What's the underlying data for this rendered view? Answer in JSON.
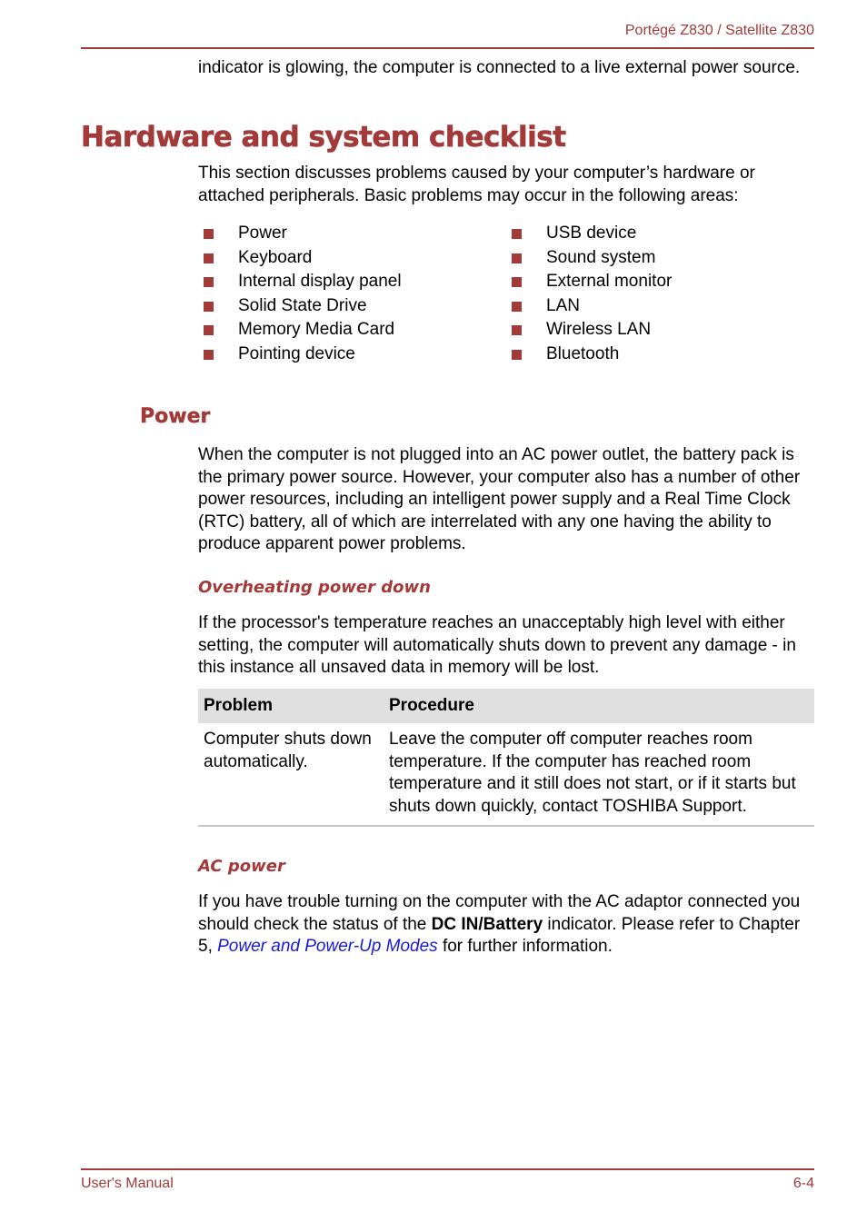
{
  "header": {
    "title": "Portégé Z830 / Satellite Z830"
  },
  "intro_continuation": "indicator is glowing, the computer is connected to a live external power source.",
  "section": {
    "title": "Hardware and system checklist",
    "intro": "This section discusses problems caused by your computer’s hardware or attached peripherals. Basic problems may occur in the following areas:",
    "areas_left": [
      "Power",
      "Keyboard",
      "Internal display panel",
      "Solid State Drive",
      "Memory Media Card",
      "Pointing device"
    ],
    "areas_right": [
      "USB device",
      "Sound system",
      "External monitor",
      "LAN",
      "Wireless LAN",
      "Bluetooth"
    ]
  },
  "power": {
    "title": "Power",
    "text": "When the computer is not plugged into an AC power outlet, the battery pack is the primary power source. However, your computer also has a number of other power resources, including an intelligent power supply and a Real Time Clock (RTC) battery, all of which are interrelated with any one having the ability to produce apparent power problems."
  },
  "overheating": {
    "title": "Overheating power down",
    "text": "If the processor's temperature reaches an unacceptably high level with either setting, the computer will automatically shuts down to prevent any damage - in this instance all unsaved data in memory will be lost.",
    "table": {
      "headers": [
        "Problem",
        "Procedure"
      ],
      "rows": [
        [
          "Computer shuts down automatically.",
          "Leave the computer off computer reaches room temperature. If the computer has reached room temperature and it still does not start, or if it starts but shuts down quickly, contact TOSHIBA Support."
        ]
      ]
    }
  },
  "ac_power": {
    "title": "AC power",
    "text_before": "If you have trouble turning on the computer with the AC adaptor connected you should check the status of the ",
    "bold": "DC IN/Battery",
    "text_middle": " indicator. Please refer to Chapter 5, ",
    "link": "Power and Power-Up Modes",
    "text_after": " for further information."
  },
  "footer": {
    "left": "User's Manual",
    "right": "6-4"
  },
  "colors": {
    "accent": "#a33a3a",
    "link": "#1a1adb",
    "table_header_bg": "#e0e0e0"
  }
}
